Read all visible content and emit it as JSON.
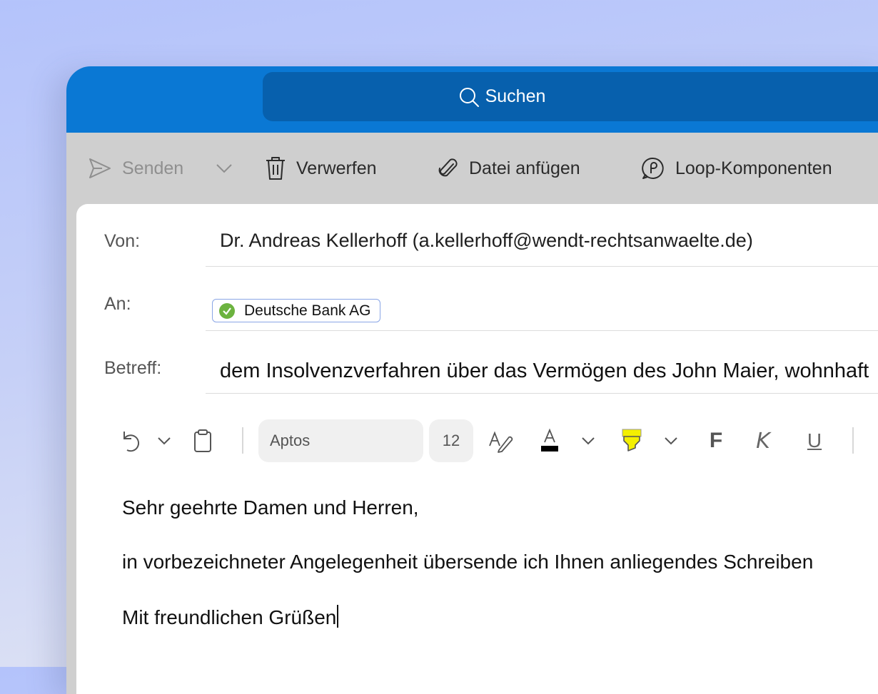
{
  "search": {
    "label": "Suchen"
  },
  "toolbar": {
    "send": "Senden",
    "discard": "Verwerfen",
    "attach": "Datei anfügen",
    "loop": "Loop-Komponenten"
  },
  "compose": {
    "from_label": "Von:",
    "from_value": "Dr. Andreas Kellerhoff (a.kellerhoff@wendt-rechtsanwaelte.de)",
    "to_label": "An:",
    "to_recipients": [
      "Deutsche Bank AG"
    ],
    "subject_label": "Betreff:",
    "subject_value": "dem Insolvenzverfahren über das Vermögen des John Maier, wohnhaft"
  },
  "format": {
    "font": "Aptos",
    "size": "12",
    "font_color": "#000000",
    "highlight_color": "#f4f000",
    "bold": "F",
    "italic": "K",
    "underline": "U"
  },
  "body": {
    "lines": [
      "Sehr geehrte Damen und Herren,",
      "in vorbezeichneter Angelegenheit übersende ich Ihnen anliegendes Schreiben",
      "Mit freundlichen Grüßen"
    ]
  },
  "colors": {
    "titlebar": "#0a78d4",
    "searchbox": "#0760ad",
    "chip_check": "#6cb33f"
  }
}
